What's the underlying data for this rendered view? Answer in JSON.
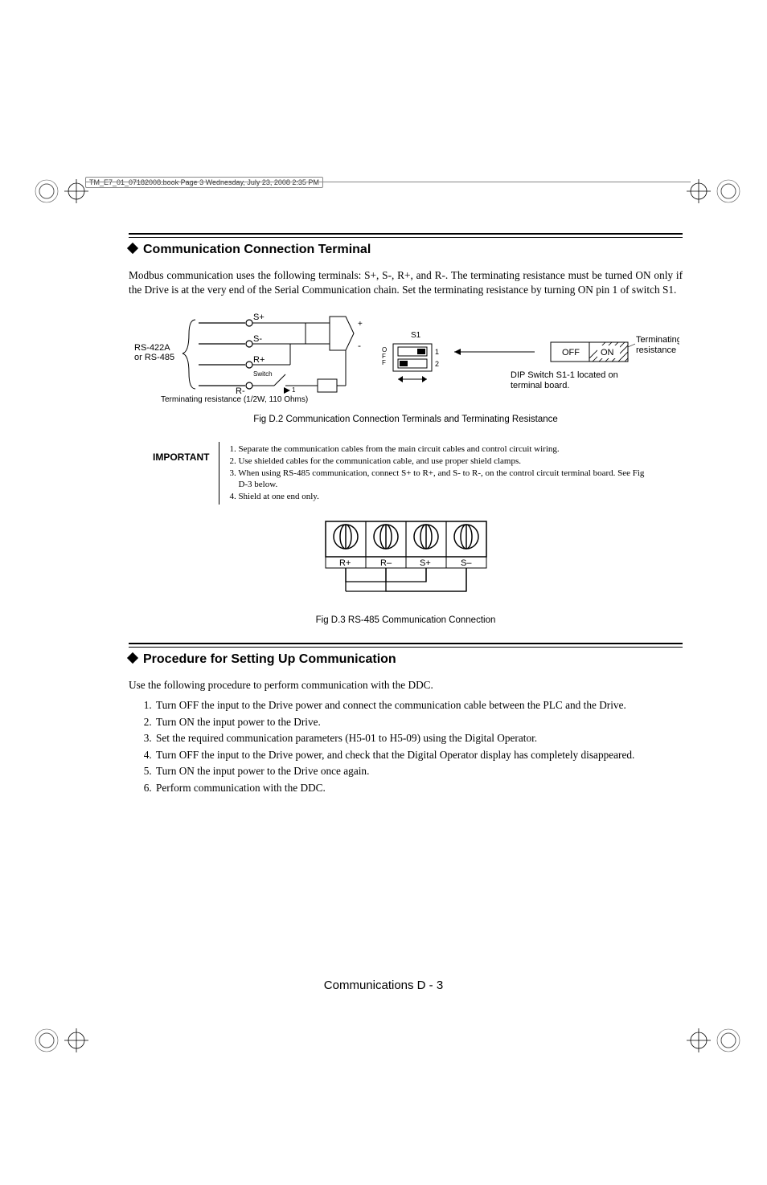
{
  "print_header": "TM_E7_01_07182008.book  Page 3  Wednesday, July 23, 2008  2:35 PM",
  "section1": {
    "heading": "Communication Connection Terminal",
    "para": "Modbus communication uses the following terminals: S+, S-, R+, and R-. The terminating resistance must be turned ON only if the Drive is at the very end of the Serial Communication chain. Set the terminating resistance by turning ON pin 1 of switch S1."
  },
  "fig_d2": {
    "caption": "Fig D.2  Communication Connection Terminals and Terminating Resistance",
    "labels": {
      "rs_label1": "RS-422A",
      "rs_label2": "or RS-485",
      "term_res1": "Terminating resistance (1/2W, 110 Ohms)",
      "switch": "Switch",
      "sp": "S+",
      "sm": "S-",
      "rp": "R+",
      "rm": "R-",
      "plus": "+",
      "minus": "-",
      "s1": "S1",
      "off_v": "OFF",
      "pin1": "1",
      "pin2": "2",
      "off": "OFF",
      "on": "ON",
      "term2_a": "Terminating",
      "term2_b": "resistance",
      "dip1": "DIP Switch S1-1 located on",
      "dip2": "terminal board."
    }
  },
  "important": {
    "label": "IMPORTANT",
    "n1": "1. Separate the communication cables from the main circuit cables and control circuit wiring.",
    "n2": "2. Use shielded cables for the communication cable, and use proper shield clamps.",
    "n3a": "3. When using RS-485 communication, connect S+ to R+, and S- to R-, on the control circuit terminal board. See Fig",
    "n3b": "D-3 below.",
    "n4": "4. Shield at one end only."
  },
  "fig_d3": {
    "caption": "Fig D.3  RS-485 Communication Connection",
    "labels": {
      "rp": "R+",
      "rm": "R–",
      "sp": "S+",
      "sm": "S–"
    }
  },
  "section2": {
    "heading": "Procedure for Setting Up Communication",
    "intro": "Use the following procedure to perform communication with the DDC.",
    "steps": [
      "Turn OFF the input to the Drive power and connect the communication cable between the PLC and the Drive.",
      "Turn ON the input power to the Drive.",
      "Set the required communication parameters (H5-01 to H5-09) using the Digital Operator.",
      "Turn OFF the input to the Drive power, and check that the Digital Operator display has completely disappeared.",
      "Turn ON the input power to the Drive once again.",
      "Perform communication with the DDC."
    ]
  },
  "footer": "Communications   D - 3"
}
